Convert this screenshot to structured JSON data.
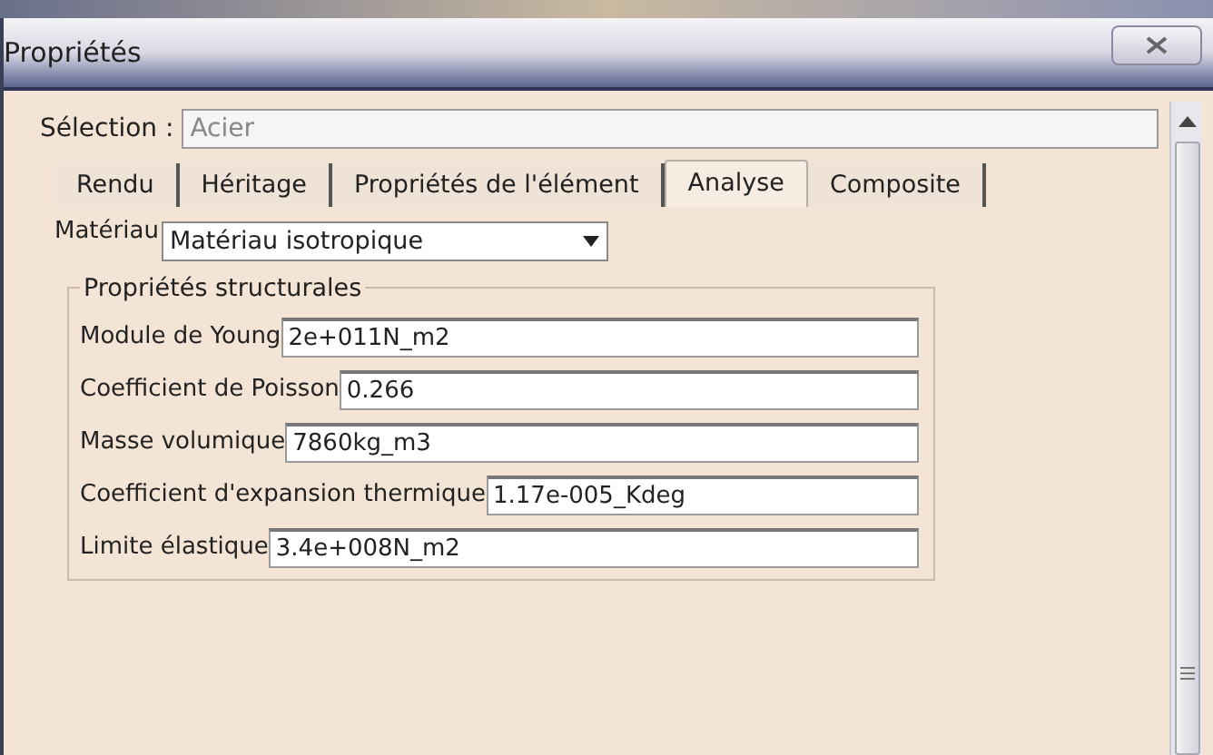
{
  "window": {
    "title": "Propriétés"
  },
  "selection": {
    "label": "Sélection :",
    "value": "Acier"
  },
  "tabs": [
    {
      "label": "Rendu",
      "selected": false
    },
    {
      "label": "Héritage",
      "selected": false
    },
    {
      "label": "Propriétés de l'élément",
      "selected": false
    },
    {
      "label": "Analyse",
      "selected": true
    },
    {
      "label": "Composite",
      "selected": false
    }
  ],
  "material": {
    "label": "Matériau",
    "value": "Matériau isotropique"
  },
  "group": {
    "title": "Propriétés structurales",
    "fields": [
      {
        "label": "Module de Young",
        "value": "2e+011N_m2"
      },
      {
        "label": "Coefficient de Poisson",
        "value": "0.266"
      },
      {
        "label": "Masse volumique",
        "value": "7860kg_m3"
      },
      {
        "label": "Coefficient d'expansion thermique",
        "value": "1.17e-005_Kdeg"
      },
      {
        "label": "Limite élastique",
        "value": "3.4e+008N_m2"
      }
    ]
  }
}
